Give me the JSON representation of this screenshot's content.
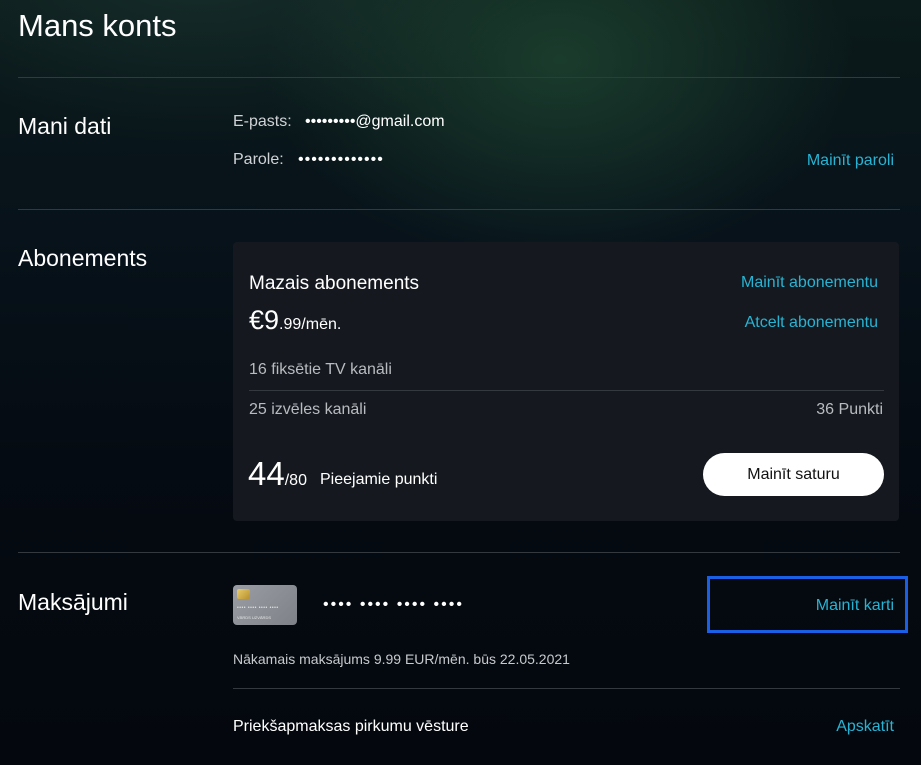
{
  "page": {
    "title": "Mans konts"
  },
  "personal": {
    "heading": "Mani dati",
    "email_label": "E-pasts:",
    "email_value": "•••••••••@gmail.com",
    "password_label": "Parole:",
    "password_value": "•••••••••••••",
    "change_password": "Mainīt paroli"
  },
  "subscription": {
    "heading": "Abonements",
    "plan_name": "Mazais abonements",
    "price_main": "€9",
    "price_suffix": ".99/mēn.",
    "change_plan": "Mainīt abonementu",
    "cancel_plan": "Atcelt abonementu",
    "fixed_channels": "16 fiksētie TV kanāli",
    "optional_channels": "25 izvēles kanāli",
    "points_cost": "36 Punkti",
    "points_available": "44",
    "points_total": "/80",
    "points_label": "Pieejamie punkti",
    "change_content": "Mainīt saturu"
  },
  "payments": {
    "heading": "Maksājumi",
    "card_masked": "•••• •••• •••• ••••",
    "card_art_dots": "•••• •••• •••• ••••",
    "card_art_name": "VĀRDS UZVĀRDS",
    "change_card": "Mainīt karti",
    "next_payment": "Nākamais maksājums 9.99 EUR/mēn. būs 22.05.2021",
    "history_label": "Priekšapmaksas pirkumu vēsture",
    "history_view": "Apskatīt"
  },
  "colors": {
    "accent": "#27b4d4",
    "highlight": "#1a5fe6"
  }
}
